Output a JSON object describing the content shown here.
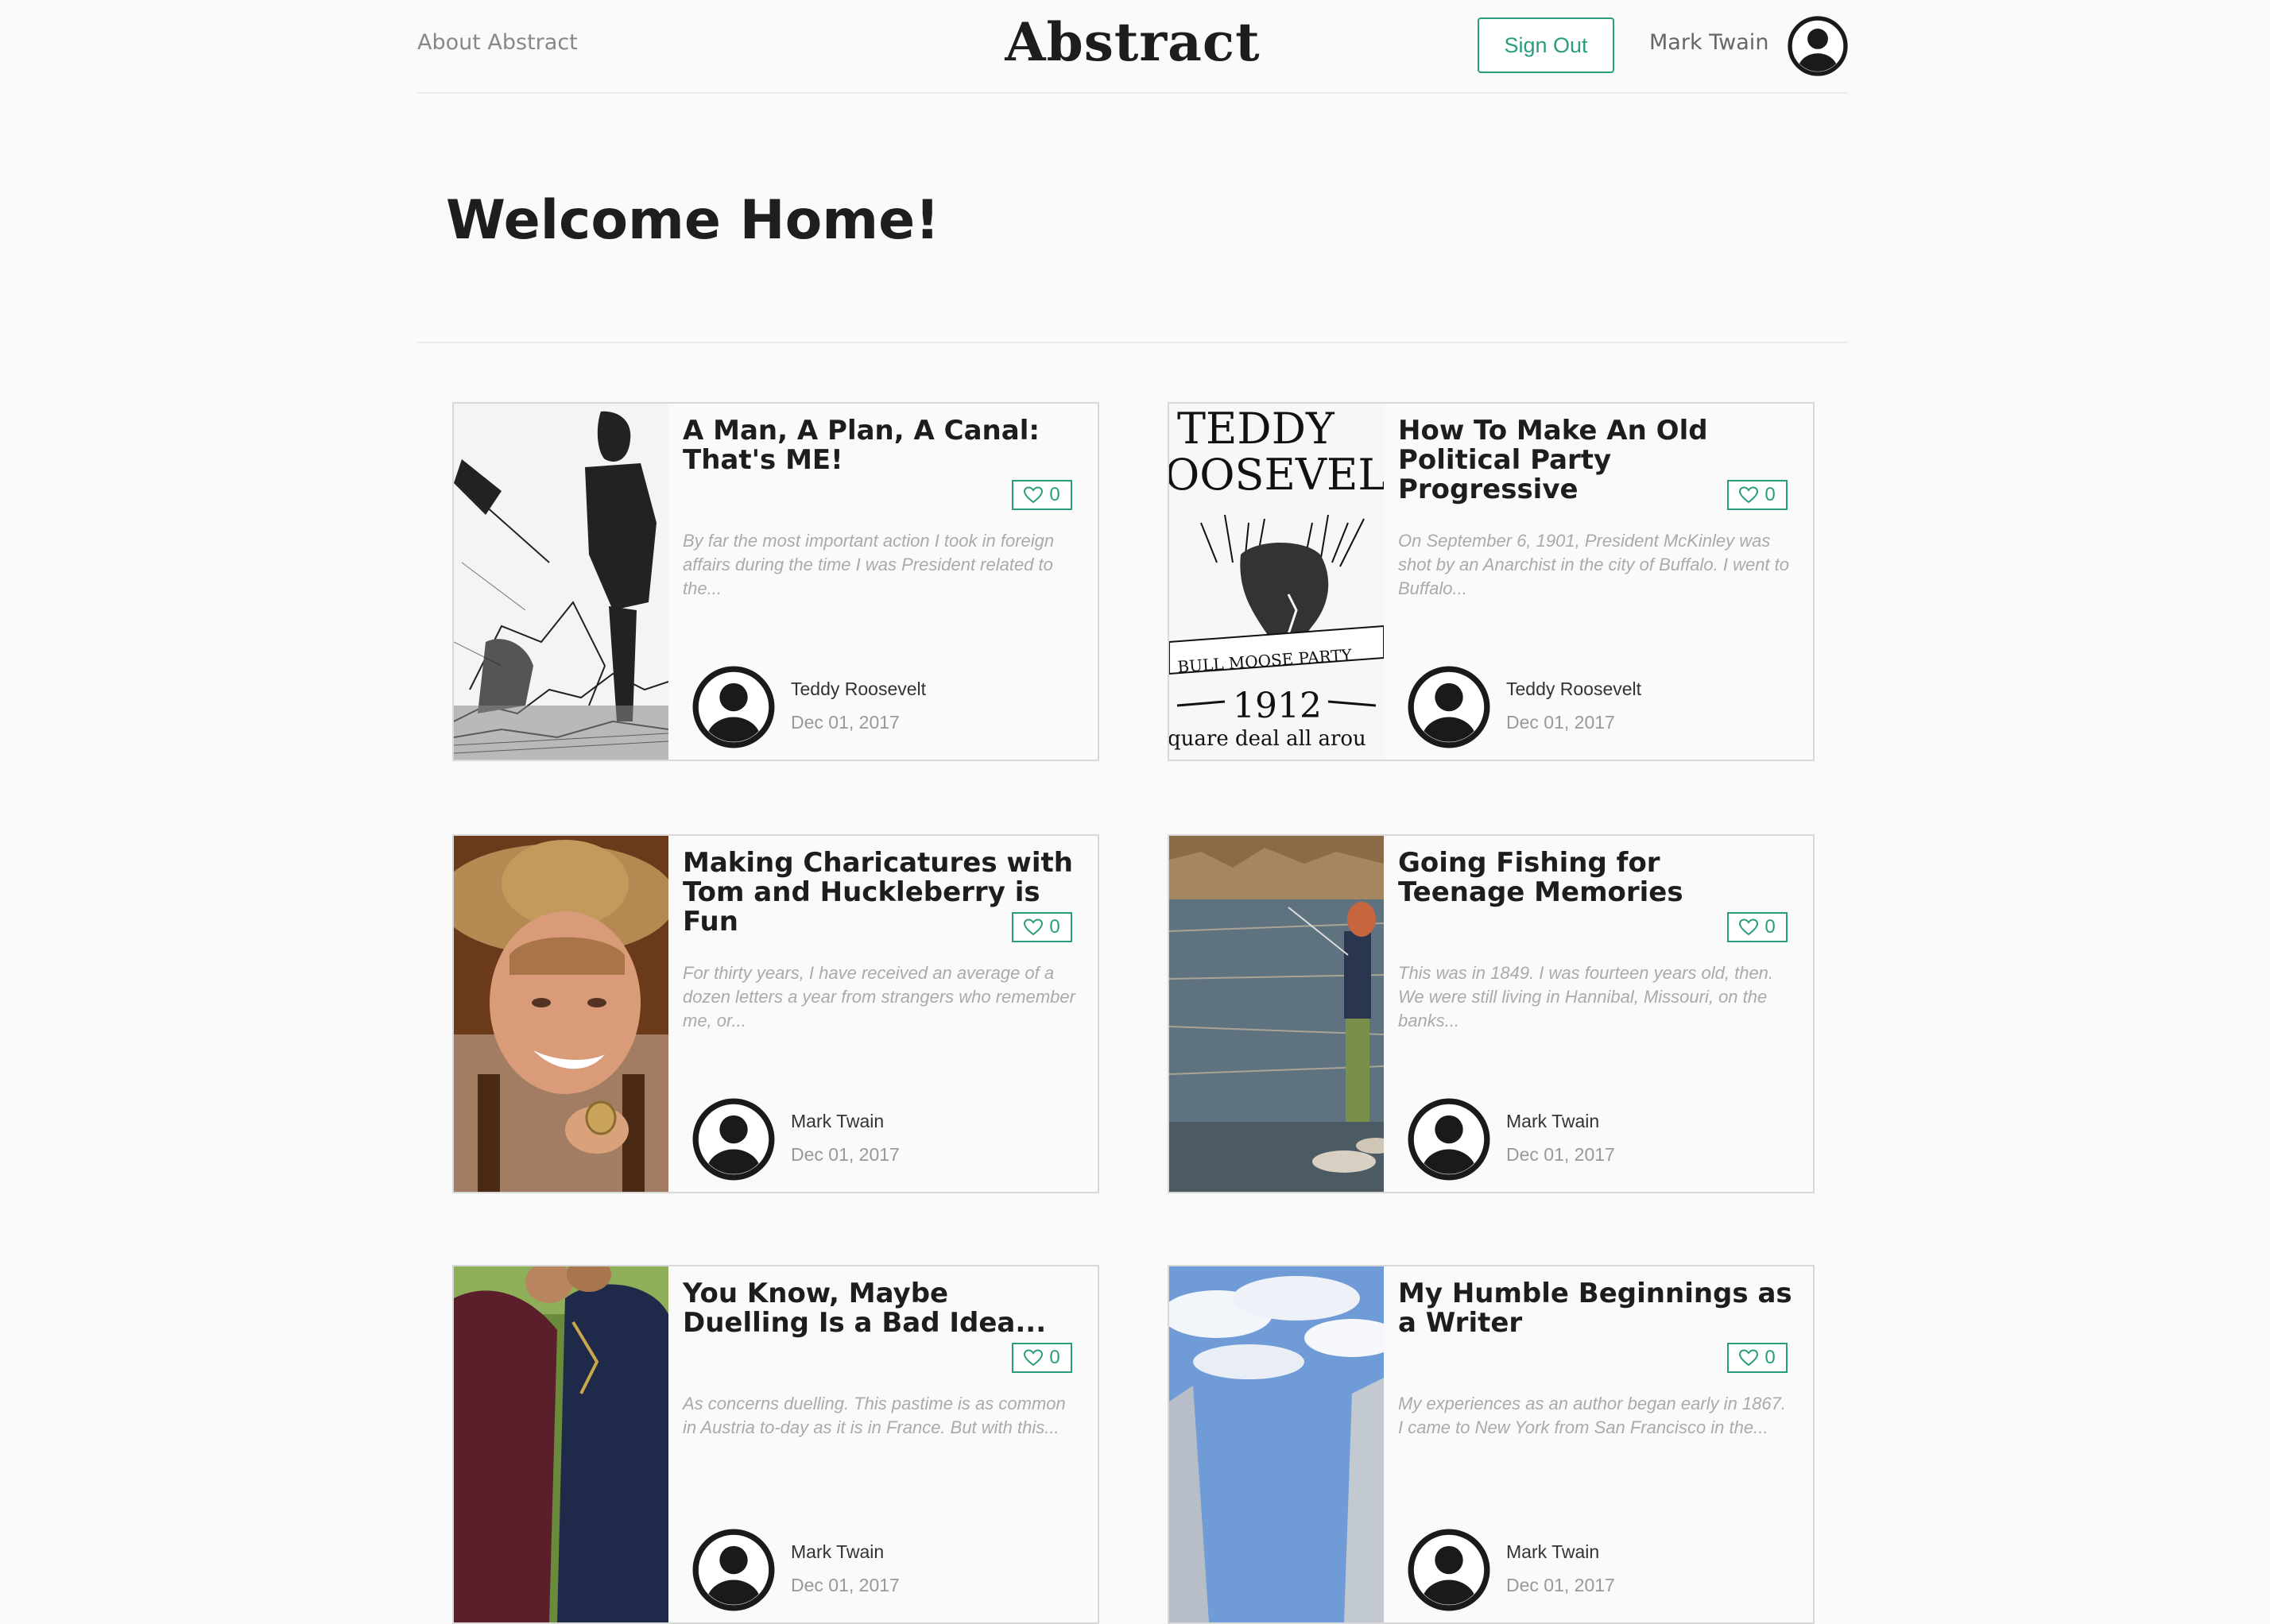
{
  "header": {
    "about_link": "About Abstract",
    "brand": "Abstract",
    "sign_out": "Sign Out",
    "username": "Mark Twain"
  },
  "hero": {
    "title": "Welcome Home!"
  },
  "colors": {
    "accent": "#2a9d7e",
    "background": "#fafafa",
    "border": "#d8d8d8"
  },
  "posts": [
    {
      "title": "A Man, A Plan, A Canal: That's ME!",
      "likes": "0",
      "excerpt": "By far the most important action I took in foreign affairs during the time I was President related to the...",
      "author": "Teddy Roosevelt",
      "date": "Dec 01, 2017",
      "image": "canal-cartoon-image"
    },
    {
      "title": "How To Make An Old Political Party Progressive",
      "likes": "0",
      "excerpt": "On September 6, 1901, President McKinley was shot by an Anarchist in the city of Buffalo. I went to Buffalo...",
      "author": "Teddy Roosevelt",
      "date": "Dec 01, 2017",
      "image": "bull-moose-poster-image",
      "image_text": {
        "line1": "TEDDY",
        "line2": "OOSEVEL",
        "banner": "BULL MOOSE PARTY",
        "year": "1912",
        "slogan": "quare deal all arou"
      }
    },
    {
      "title": "Making Charicatures with Tom and Huckleberry is Fun",
      "likes": "0",
      "excerpt": "For thirty years, I have received an average of a dozen letters a year from strangers who remember me, or...",
      "author": "Mark Twain",
      "date": "Dec 01, 2017",
      "image": "boy-straw-hat-image"
    },
    {
      "title": "Going Fishing for Teenage Memories",
      "likes": "0",
      "excerpt": "This was in 1849. I was fourteen years old, then. We were still living in Hannibal, Missouri, on the banks...",
      "author": "Mark Twain",
      "date": "Dec 01, 2017",
      "image": "river-fishing-image"
    },
    {
      "title": "You Know, Maybe Duelling Is a Bad Idea...",
      "likes": "0",
      "excerpt": "As concerns duelling. This pastime is as common in Austria to-day as it is in France. But with this...",
      "author": "Mark Twain",
      "date": "Dec 01, 2017",
      "image": "duelists-image"
    },
    {
      "title": "My Humble Beginnings as a Writer",
      "likes": "0",
      "excerpt": "My experiences as an author began early in 1867. I came to New York from San Francisco in the...",
      "author": "Mark Twain",
      "date": "Dec 01, 2017",
      "image": "sky-cliffs-image"
    }
  ]
}
